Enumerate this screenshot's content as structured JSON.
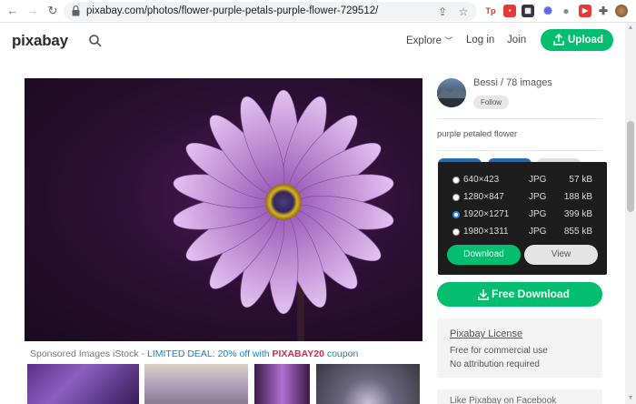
{
  "browser": {
    "url": "pixabay.com/photos/flower-purple-petals-purple-flower-729512/"
  },
  "header": {
    "logo": "pixabay",
    "explore": "Explore",
    "login": "Log in",
    "join": "Join",
    "upload": "Upload"
  },
  "author": {
    "name": "Bessi / 78 images",
    "follow": "Follow"
  },
  "description": "purple petaled flower",
  "download_menu": {
    "sizes": [
      {
        "label": "640×423",
        "type": "JPG",
        "size": "57 kB",
        "selected": false
      },
      {
        "label": "1280×847",
        "type": "JPG",
        "size": "188 kB",
        "selected": false
      },
      {
        "label": "1920×1271",
        "type": "JPG",
        "size": "399 kB",
        "selected": true
      },
      {
        "label": "1980×1311",
        "type": "JPG",
        "size": "855 kB",
        "selected": false
      }
    ],
    "download": "Download",
    "view": "View"
  },
  "free_download": "Free Download",
  "license": {
    "title": "Pixabay License",
    "line1": "Free for commercial use",
    "line2": "No attribution required"
  },
  "facebook": "Like Pixabay on Facebook",
  "sponsored": {
    "prefix": "Sponsored Images iStock - ",
    "deal": "LIMITED DEAL: 20% off with ",
    "code": "PIXABAY20",
    "suffix": " coupon"
  },
  "colors": {
    "accent": "#02be6e",
    "coupon": "#e0244b",
    "link": "#1a7fc4"
  }
}
